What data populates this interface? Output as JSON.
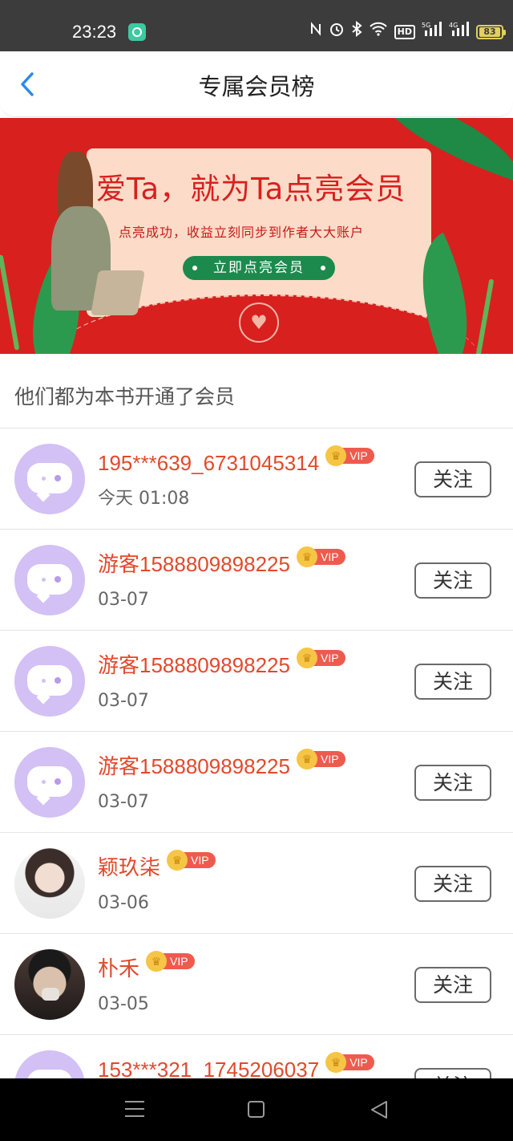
{
  "status_bar": {
    "time": "23:23",
    "icons": [
      "nfc-icon",
      "alarm-icon",
      "bluetooth-icon",
      "wifi-icon",
      "hd-icon",
      "signal-5g-icon",
      "signal-4g-icon",
      "battery-icon"
    ],
    "hd_label": "HD",
    "net1": "5G",
    "net2": "4G",
    "battery": "83"
  },
  "header": {
    "title": "专属会员榜"
  },
  "banner": {
    "title": "爱Ta，就为Ta点亮会员",
    "subtitle": "点亮成功，收益立刻同步到作者大大账户",
    "button_label": "立即点亮会员",
    "colors": {
      "background": "#d8201f",
      "card": "#fcdcc8",
      "button": "#1d8a4d"
    }
  },
  "section": {
    "label": "他们都为本书开通了会员"
  },
  "members": [
    {
      "name": "195***639_6731045314",
      "time": "今天 01:08",
      "avatar": "default",
      "vip": "VIP",
      "follow": "关注"
    },
    {
      "name": "游客1588809898225",
      "time": "03-07",
      "avatar": "default",
      "vip": "VIP",
      "follow": "关注"
    },
    {
      "name": "游客1588809898225",
      "time": "03-07",
      "avatar": "default",
      "vip": "VIP",
      "follow": "关注"
    },
    {
      "name": "游客1588809898225",
      "time": "03-07",
      "avatar": "default",
      "vip": "VIP",
      "follow": "关注"
    },
    {
      "name": "颖玖柒",
      "time": "03-06",
      "avatar": "photo-woman",
      "vip": "VIP",
      "follow": "关注"
    },
    {
      "name": "朴禾",
      "time": "03-05",
      "avatar": "photo-man",
      "vip": "VIP",
      "follow": "关注"
    },
    {
      "name": "153***321_1745206037",
      "time": "",
      "avatar": "default",
      "vip": "VIP",
      "follow": "关注"
    }
  ],
  "colors": {
    "name": "#e2492b",
    "vip_tag": "#ee5b4e",
    "vip_crown": "#f6c545",
    "avatar_default": "#d3c0f5",
    "back_arrow": "#2b8be6"
  }
}
